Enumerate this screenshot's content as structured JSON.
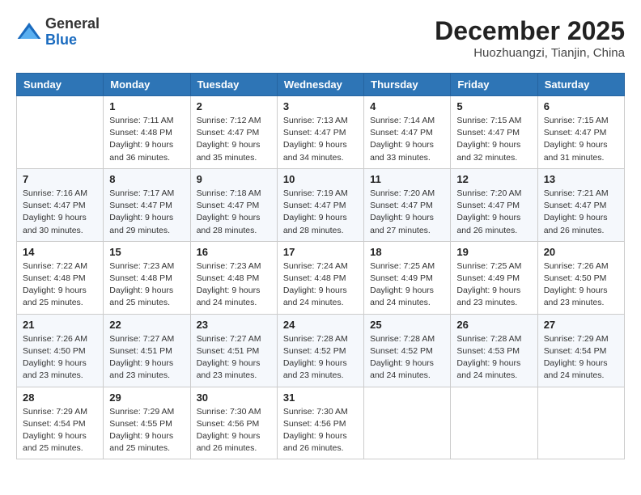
{
  "logo": {
    "general": "General",
    "blue": "Blue"
  },
  "title": "December 2025",
  "location": "Huozhuangzi, Tianjin, China",
  "headers": [
    "Sunday",
    "Monday",
    "Tuesday",
    "Wednesday",
    "Thursday",
    "Friday",
    "Saturday"
  ],
  "weeks": [
    [
      {
        "day": "",
        "info": ""
      },
      {
        "day": "1",
        "info": "Sunrise: 7:11 AM\nSunset: 4:48 PM\nDaylight: 9 hours\nand 36 minutes."
      },
      {
        "day": "2",
        "info": "Sunrise: 7:12 AM\nSunset: 4:47 PM\nDaylight: 9 hours\nand 35 minutes."
      },
      {
        "day": "3",
        "info": "Sunrise: 7:13 AM\nSunset: 4:47 PM\nDaylight: 9 hours\nand 34 minutes."
      },
      {
        "day": "4",
        "info": "Sunrise: 7:14 AM\nSunset: 4:47 PM\nDaylight: 9 hours\nand 33 minutes."
      },
      {
        "day": "5",
        "info": "Sunrise: 7:15 AM\nSunset: 4:47 PM\nDaylight: 9 hours\nand 32 minutes."
      },
      {
        "day": "6",
        "info": "Sunrise: 7:15 AM\nSunset: 4:47 PM\nDaylight: 9 hours\nand 31 minutes."
      }
    ],
    [
      {
        "day": "7",
        "info": "Sunrise: 7:16 AM\nSunset: 4:47 PM\nDaylight: 9 hours\nand 30 minutes."
      },
      {
        "day": "8",
        "info": "Sunrise: 7:17 AM\nSunset: 4:47 PM\nDaylight: 9 hours\nand 29 minutes."
      },
      {
        "day": "9",
        "info": "Sunrise: 7:18 AM\nSunset: 4:47 PM\nDaylight: 9 hours\nand 28 minutes."
      },
      {
        "day": "10",
        "info": "Sunrise: 7:19 AM\nSunset: 4:47 PM\nDaylight: 9 hours\nand 28 minutes."
      },
      {
        "day": "11",
        "info": "Sunrise: 7:20 AM\nSunset: 4:47 PM\nDaylight: 9 hours\nand 27 minutes."
      },
      {
        "day": "12",
        "info": "Sunrise: 7:20 AM\nSunset: 4:47 PM\nDaylight: 9 hours\nand 26 minutes."
      },
      {
        "day": "13",
        "info": "Sunrise: 7:21 AM\nSunset: 4:47 PM\nDaylight: 9 hours\nand 26 minutes."
      }
    ],
    [
      {
        "day": "14",
        "info": "Sunrise: 7:22 AM\nSunset: 4:48 PM\nDaylight: 9 hours\nand 25 minutes."
      },
      {
        "day": "15",
        "info": "Sunrise: 7:23 AM\nSunset: 4:48 PM\nDaylight: 9 hours\nand 25 minutes."
      },
      {
        "day": "16",
        "info": "Sunrise: 7:23 AM\nSunset: 4:48 PM\nDaylight: 9 hours\nand 24 minutes."
      },
      {
        "day": "17",
        "info": "Sunrise: 7:24 AM\nSunset: 4:48 PM\nDaylight: 9 hours\nand 24 minutes."
      },
      {
        "day": "18",
        "info": "Sunrise: 7:25 AM\nSunset: 4:49 PM\nDaylight: 9 hours\nand 24 minutes."
      },
      {
        "day": "19",
        "info": "Sunrise: 7:25 AM\nSunset: 4:49 PM\nDaylight: 9 hours\nand 23 minutes."
      },
      {
        "day": "20",
        "info": "Sunrise: 7:26 AM\nSunset: 4:50 PM\nDaylight: 9 hours\nand 23 minutes."
      }
    ],
    [
      {
        "day": "21",
        "info": "Sunrise: 7:26 AM\nSunset: 4:50 PM\nDaylight: 9 hours\nand 23 minutes."
      },
      {
        "day": "22",
        "info": "Sunrise: 7:27 AM\nSunset: 4:51 PM\nDaylight: 9 hours\nand 23 minutes."
      },
      {
        "day": "23",
        "info": "Sunrise: 7:27 AM\nSunset: 4:51 PM\nDaylight: 9 hours\nand 23 minutes."
      },
      {
        "day": "24",
        "info": "Sunrise: 7:28 AM\nSunset: 4:52 PM\nDaylight: 9 hours\nand 23 minutes."
      },
      {
        "day": "25",
        "info": "Sunrise: 7:28 AM\nSunset: 4:52 PM\nDaylight: 9 hours\nand 24 minutes."
      },
      {
        "day": "26",
        "info": "Sunrise: 7:28 AM\nSunset: 4:53 PM\nDaylight: 9 hours\nand 24 minutes."
      },
      {
        "day": "27",
        "info": "Sunrise: 7:29 AM\nSunset: 4:54 PM\nDaylight: 9 hours\nand 24 minutes."
      }
    ],
    [
      {
        "day": "28",
        "info": "Sunrise: 7:29 AM\nSunset: 4:54 PM\nDaylight: 9 hours\nand 25 minutes."
      },
      {
        "day": "29",
        "info": "Sunrise: 7:29 AM\nSunset: 4:55 PM\nDaylight: 9 hours\nand 25 minutes."
      },
      {
        "day": "30",
        "info": "Sunrise: 7:30 AM\nSunset: 4:56 PM\nDaylight: 9 hours\nand 26 minutes."
      },
      {
        "day": "31",
        "info": "Sunrise: 7:30 AM\nSunset: 4:56 PM\nDaylight: 9 hours\nand 26 minutes."
      },
      {
        "day": "",
        "info": ""
      },
      {
        "day": "",
        "info": ""
      },
      {
        "day": "",
        "info": ""
      }
    ]
  ]
}
